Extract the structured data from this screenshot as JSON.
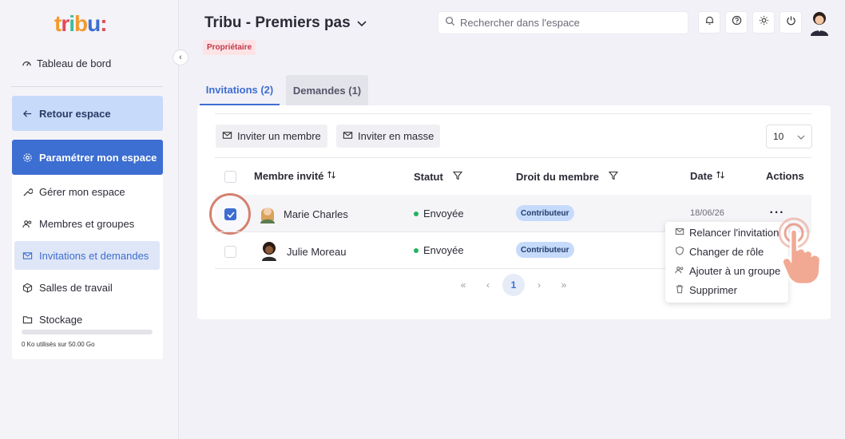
{
  "brand": {
    "logo_text": "tribu:"
  },
  "sidebar": {
    "dashboard": "Tableau de bord",
    "back": "Retour espace",
    "settings": "Paramétrer mon espace",
    "items": [
      {
        "label": "Gérer mon espace"
      },
      {
        "label": "Membres et groupes"
      },
      {
        "label": "Invitations et demandes"
      },
      {
        "label": "Salles de travail"
      },
      {
        "label": "Stockage"
      }
    ],
    "storage_text": "0 Ko utilisés sur 50.00 Go",
    "storage_used_fraction": 0
  },
  "header": {
    "title": "Tribu - Premiers pas",
    "role_badge": "Propriétaire",
    "search_placeholder": "Rechercher dans l'espace"
  },
  "tabs": [
    {
      "label": "Invitations (2)",
      "active": true
    },
    {
      "label": "Demandes (1)",
      "active": false
    }
  ],
  "toolbar": {
    "invite_member": "Inviter un membre",
    "invite_bulk": "Inviter en masse",
    "page_size": "10"
  },
  "table": {
    "columns": [
      "Membre invité",
      "Statut",
      "Droit du membre",
      "Date",
      "Actions"
    ],
    "rows": [
      {
        "name": "Marie Charles",
        "status": "Envoyée",
        "role": "Contributeur",
        "date": "18/06/26",
        "checked": true
      },
      {
        "name": "Julie Moreau",
        "status": "Envoyée",
        "role": "Contributeur",
        "date": "",
        "checked": false
      }
    ]
  },
  "pagination": {
    "first": "«",
    "prev": "‹",
    "current": "1",
    "next": "›",
    "last": "»"
  },
  "actions_menu": {
    "more": "···",
    "items": [
      {
        "label": "Relancer l'invitation"
      },
      {
        "label": "Changer de rôle"
      },
      {
        "label": "Ajouter à un groupe"
      },
      {
        "label": "Supprimer"
      }
    ]
  },
  "colors": {
    "primary": "#3d6ed1",
    "accent_soft": "#c7dafa",
    "status_green": "#22b35e",
    "badge_red": "#c0394a"
  }
}
